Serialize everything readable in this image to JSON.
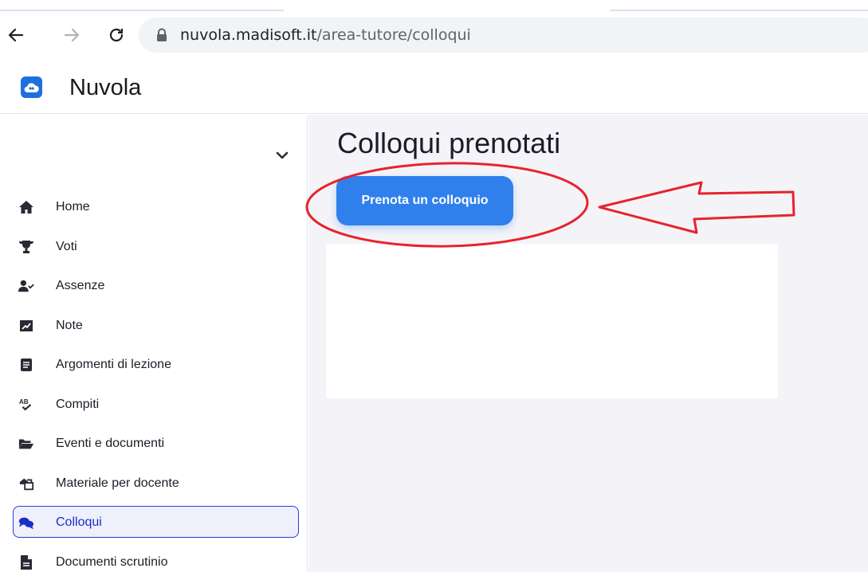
{
  "browser": {
    "url_domain": "nuvola.madisoft.it",
    "url_path": "/area-tutore/colloqui"
  },
  "app": {
    "title": "Nuvola"
  },
  "sidebar": {
    "items": [
      {
        "label": "Home",
        "icon": "home-icon"
      },
      {
        "label": "Voti",
        "icon": "trophy-icon"
      },
      {
        "label": "Assenze",
        "icon": "user-check-icon"
      },
      {
        "label": "Note",
        "icon": "note-icon"
      },
      {
        "label": "Argomenti di lezione",
        "icon": "book-icon"
      },
      {
        "label": "Compiti",
        "icon": "spellcheck-icon"
      },
      {
        "label": "Eventi e documenti",
        "icon": "folder-open-icon"
      },
      {
        "label": "Materiale per docente",
        "icon": "materials-icon"
      },
      {
        "label": "Colloqui",
        "icon": "comments-icon",
        "active": true
      },
      {
        "label": "Documenti scrutinio",
        "icon": "file-icon"
      }
    ]
  },
  "main": {
    "title": "Colloqui prenotati",
    "cta_label": "Prenota un colloquio"
  },
  "colors": {
    "accent": "#2f80ed",
    "active_nav": "#1a2ec9",
    "annotation": "#e8232b"
  }
}
